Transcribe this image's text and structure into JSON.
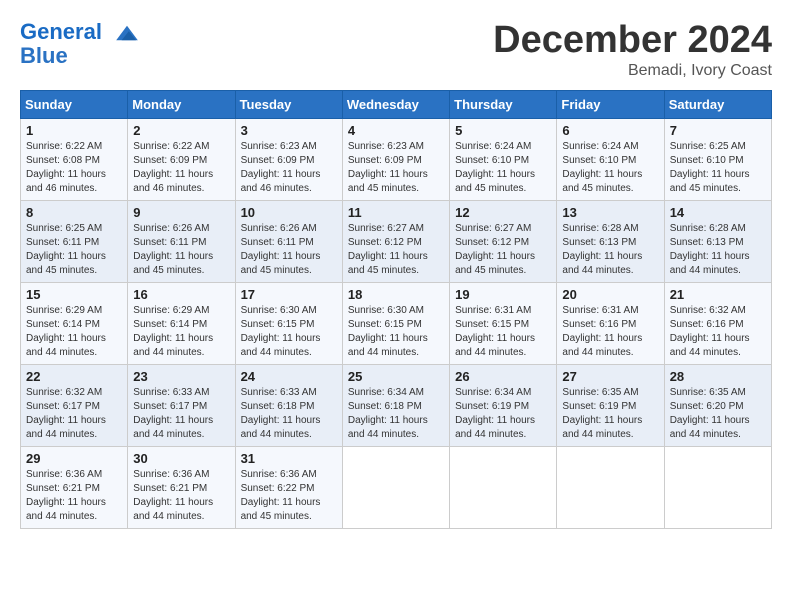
{
  "header": {
    "logo_line1": "General",
    "logo_line2": "Blue",
    "month_title": "December 2024",
    "location": "Bemadi, Ivory Coast"
  },
  "weekdays": [
    "Sunday",
    "Monday",
    "Tuesday",
    "Wednesday",
    "Thursday",
    "Friday",
    "Saturday"
  ],
  "weeks": [
    [
      {
        "day": "1",
        "sunrise": "6:22 AM",
        "sunset": "6:08 PM",
        "daylight": "11 hours and 46 minutes."
      },
      {
        "day": "2",
        "sunrise": "6:22 AM",
        "sunset": "6:09 PM",
        "daylight": "11 hours and 46 minutes."
      },
      {
        "day": "3",
        "sunrise": "6:23 AM",
        "sunset": "6:09 PM",
        "daylight": "11 hours and 46 minutes."
      },
      {
        "day": "4",
        "sunrise": "6:23 AM",
        "sunset": "6:09 PM",
        "daylight": "11 hours and 45 minutes."
      },
      {
        "day": "5",
        "sunrise": "6:24 AM",
        "sunset": "6:10 PM",
        "daylight": "11 hours and 45 minutes."
      },
      {
        "day": "6",
        "sunrise": "6:24 AM",
        "sunset": "6:10 PM",
        "daylight": "11 hours and 45 minutes."
      },
      {
        "day": "7",
        "sunrise": "6:25 AM",
        "sunset": "6:10 PM",
        "daylight": "11 hours and 45 minutes."
      }
    ],
    [
      {
        "day": "8",
        "sunrise": "6:25 AM",
        "sunset": "6:11 PM",
        "daylight": "11 hours and 45 minutes."
      },
      {
        "day": "9",
        "sunrise": "6:26 AM",
        "sunset": "6:11 PM",
        "daylight": "11 hours and 45 minutes."
      },
      {
        "day": "10",
        "sunrise": "6:26 AM",
        "sunset": "6:11 PM",
        "daylight": "11 hours and 45 minutes."
      },
      {
        "day": "11",
        "sunrise": "6:27 AM",
        "sunset": "6:12 PM",
        "daylight": "11 hours and 45 minutes."
      },
      {
        "day": "12",
        "sunrise": "6:27 AM",
        "sunset": "6:12 PM",
        "daylight": "11 hours and 45 minutes."
      },
      {
        "day": "13",
        "sunrise": "6:28 AM",
        "sunset": "6:13 PM",
        "daylight": "11 hours and 44 minutes."
      },
      {
        "day": "14",
        "sunrise": "6:28 AM",
        "sunset": "6:13 PM",
        "daylight": "11 hours and 44 minutes."
      }
    ],
    [
      {
        "day": "15",
        "sunrise": "6:29 AM",
        "sunset": "6:14 PM",
        "daylight": "11 hours and 44 minutes."
      },
      {
        "day": "16",
        "sunrise": "6:29 AM",
        "sunset": "6:14 PM",
        "daylight": "11 hours and 44 minutes."
      },
      {
        "day": "17",
        "sunrise": "6:30 AM",
        "sunset": "6:15 PM",
        "daylight": "11 hours and 44 minutes."
      },
      {
        "day": "18",
        "sunrise": "6:30 AM",
        "sunset": "6:15 PM",
        "daylight": "11 hours and 44 minutes."
      },
      {
        "day": "19",
        "sunrise": "6:31 AM",
        "sunset": "6:15 PM",
        "daylight": "11 hours and 44 minutes."
      },
      {
        "day": "20",
        "sunrise": "6:31 AM",
        "sunset": "6:16 PM",
        "daylight": "11 hours and 44 minutes."
      },
      {
        "day": "21",
        "sunrise": "6:32 AM",
        "sunset": "6:16 PM",
        "daylight": "11 hours and 44 minutes."
      }
    ],
    [
      {
        "day": "22",
        "sunrise": "6:32 AM",
        "sunset": "6:17 PM",
        "daylight": "11 hours and 44 minutes."
      },
      {
        "day": "23",
        "sunrise": "6:33 AM",
        "sunset": "6:17 PM",
        "daylight": "11 hours and 44 minutes."
      },
      {
        "day": "24",
        "sunrise": "6:33 AM",
        "sunset": "6:18 PM",
        "daylight": "11 hours and 44 minutes."
      },
      {
        "day": "25",
        "sunrise": "6:34 AM",
        "sunset": "6:18 PM",
        "daylight": "11 hours and 44 minutes."
      },
      {
        "day": "26",
        "sunrise": "6:34 AM",
        "sunset": "6:19 PM",
        "daylight": "11 hours and 44 minutes."
      },
      {
        "day": "27",
        "sunrise": "6:35 AM",
        "sunset": "6:19 PM",
        "daylight": "11 hours and 44 minutes."
      },
      {
        "day": "28",
        "sunrise": "6:35 AM",
        "sunset": "6:20 PM",
        "daylight": "11 hours and 44 minutes."
      }
    ],
    [
      {
        "day": "29",
        "sunrise": "6:36 AM",
        "sunset": "6:21 PM",
        "daylight": "11 hours and 44 minutes."
      },
      {
        "day": "30",
        "sunrise": "6:36 AM",
        "sunset": "6:21 PM",
        "daylight": "11 hours and 44 minutes."
      },
      {
        "day": "31",
        "sunrise": "6:36 AM",
        "sunset": "6:22 PM",
        "daylight": "11 hours and 45 minutes."
      },
      null,
      null,
      null,
      null
    ]
  ]
}
